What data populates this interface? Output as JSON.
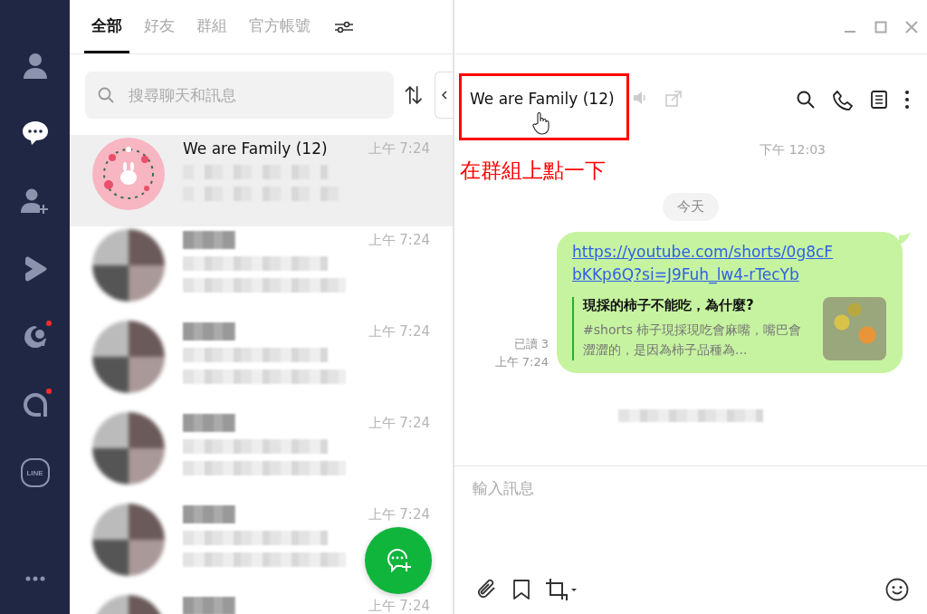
{
  "rail": {
    "items": [
      {
        "kind": "friends",
        "selected": false,
        "badge": false
      },
      {
        "kind": "chats",
        "selected": true,
        "badge": false
      },
      {
        "kind": "add-friend",
        "selected": false,
        "badge": false
      },
      {
        "kind": "voom",
        "selected": false,
        "badge": false
      },
      {
        "kind": "today",
        "selected": false,
        "badge": true
      },
      {
        "kind": "a",
        "selected": false,
        "badge": true
      },
      {
        "kind": "line",
        "label": "LINE",
        "selected": false,
        "badge": false
      }
    ]
  },
  "tabs": [
    {
      "label": "全部",
      "selected": true
    },
    {
      "label": "好友",
      "selected": false
    },
    {
      "label": "群組",
      "selected": false
    },
    {
      "label": "官方帳號",
      "selected": false
    }
  ],
  "search": {
    "placeholder": "搜尋聊天和訊息"
  },
  "chats": [
    {
      "kind": "group",
      "name": "We are Family (12)",
      "time": "上午 7:24",
      "selected": true
    },
    {
      "kind": "hidden",
      "time": "上午 7:24",
      "selected": false
    },
    {
      "kind": "hidden",
      "time": "上午 7:24",
      "selected": false
    },
    {
      "kind": "hidden",
      "time": "上午 7:24",
      "selected": false
    },
    {
      "kind": "hidden",
      "time": "上午 7:24",
      "selected": false
    },
    {
      "kind": "hidden",
      "time": "上午 7:24",
      "selected": false
    }
  ],
  "chat": {
    "title": "We are Family (12)",
    "annotation": "在群組上點一下",
    "earlier_time": "下午 12:03",
    "date": "今天",
    "message": {
      "link": "https://youtube.com/shorts/0g8cFbKKp6Q?si=J9Fuh_lw4-rTecYb",
      "preview_title": "現採的柿子不能吃，為什麼?",
      "preview_text": "#shorts 柿子現採現吃會麻嘴，嘴巴會澀澀的，是因為柿子品種為...",
      "read": "已讀 3",
      "time": "上午 7:24"
    },
    "input": {
      "placeholder": "輸入訊息"
    }
  }
}
